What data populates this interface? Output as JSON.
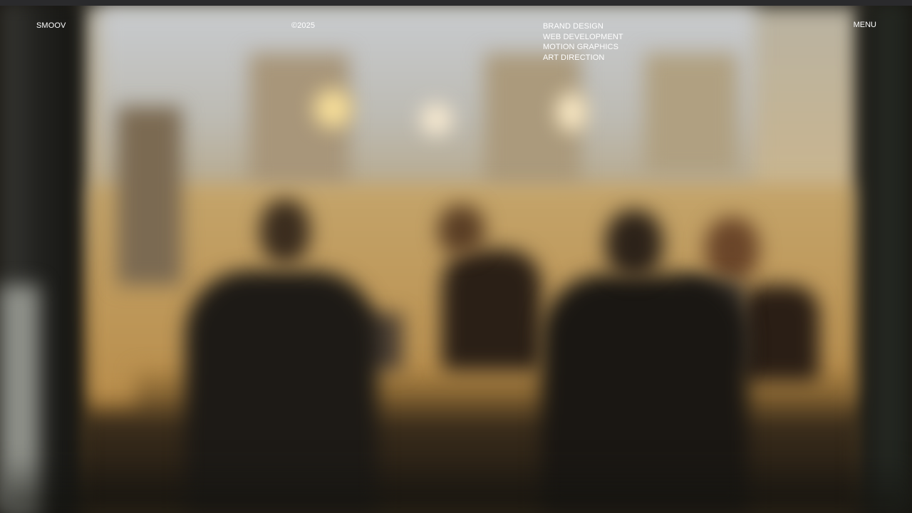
{
  "header": {
    "logo": "SMOOV",
    "copyright": "©2025",
    "services": [
      {
        "label": "BRAND DESIGN"
      },
      {
        "label": "WEB DEVELOPMENT"
      },
      {
        "label": "MOTION GRAPHICS"
      },
      {
        "label": "ART DIRECTION"
      }
    ],
    "menu_label": "MENU"
  },
  "hero": {
    "image_alt": "blurred-office-meeting-photo"
  },
  "colors": {
    "text": "#ffffff",
    "top_strip": "#2a2a2c",
    "warm_light": "#c4a46a"
  }
}
